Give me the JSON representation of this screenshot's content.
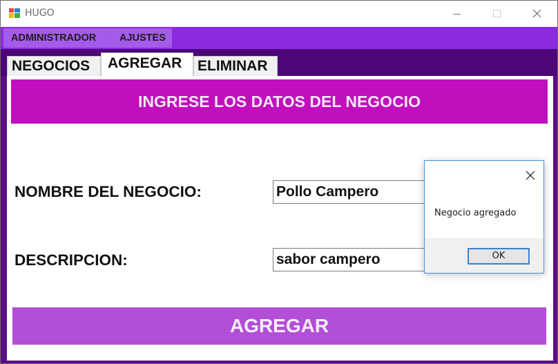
{
  "window": {
    "title": "HUGO",
    "icon": "windows-forms-app-icon"
  },
  "titlebar_buttons": [
    "minimize-icon",
    "maximize-icon",
    "close-icon"
  ],
  "menu": {
    "items": [
      {
        "label": "ADMINISTRADOR"
      },
      {
        "label": "AJUSTES"
      }
    ]
  },
  "tabs": [
    {
      "label": "NEGOCIOS",
      "selected": false
    },
    {
      "label": "AGREGAR",
      "selected": true
    },
    {
      "label": "ELIMINAR",
      "selected": false
    }
  ],
  "form": {
    "header": "INGRESE LOS DATOS DEL NEGOCIO",
    "nombre_label": "NOMBRE DEL NEGOCIO:",
    "nombre_value": "Pollo Campero",
    "descripcion_label": "DESCRIPCION:",
    "descripcion_value": "sabor campero",
    "submit_label": "AGREGAR"
  },
  "dialog": {
    "message": "Negocio agregado",
    "ok_label": "OK"
  },
  "colors": {
    "menubar": "#8a2be2",
    "tabstrip": "#4d0677",
    "header_banner": "#c10fbe",
    "submit_button": "#b24fd6",
    "dialog_border": "#4a90d9"
  }
}
